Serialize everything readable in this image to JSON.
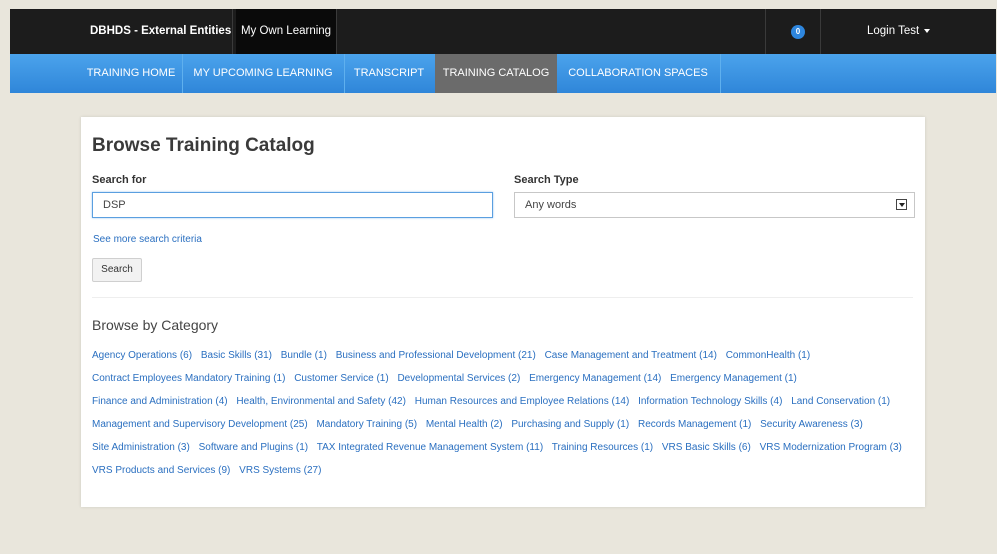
{
  "topbar": {
    "brand": "DBHDS - External Entities",
    "my_own_learning": "My Own Learning",
    "notification_count": "0",
    "user_label": "Login Test"
  },
  "nav": {
    "items": [
      "TRAINING HOME",
      "MY UPCOMING LEARNING",
      "TRANSCRIPT",
      "TRAINING CATALOG",
      "COLLABORATION SPACES"
    ],
    "active": "TRAINING CATALOG"
  },
  "catalog": {
    "title": "Browse Training Catalog",
    "search_for_label": "Search for",
    "search_value": "DSP",
    "search_type_label": "Search Type",
    "search_type_value": "Any words",
    "more_criteria": "See more search criteria",
    "search_button": "Search",
    "browse_title": "Browse by Category",
    "categories": [
      "Agency Operations (6)",
      "Basic Skills (31)",
      "Bundle (1)",
      "Business and Professional Development (21)",
      "Case Management and Treatment (14)",
      "CommonHealth (1)",
      "Contract Employees Mandatory Training (1)",
      "Customer Service (1)",
      "Developmental Services (2)",
      "Emergency Management (14)",
      "Emergency Management (1)",
      "Finance and Administration (4)",
      "Health, Environmental and Safety (42)",
      "Human Resources and Employee Relations (14)",
      "Information Technology Skills (4)",
      "Land Conservation (1)",
      "Management and Supervisory Development (25)",
      "Mandatory Training (5)",
      "Mental Health (2)",
      "Purchasing and Supply (1)",
      "Records Management (1)",
      "Security Awareness (3)",
      "Site Administration (3)",
      "Software and Plugins (1)",
      "TAX Integrated Revenue Management System (11)",
      "Training Resources (1)",
      "VRS Basic Skills (6)",
      "VRS Modernization Program (3)",
      "VRS Products and Services (9)",
      "VRS Systems (27)"
    ]
  },
  "colors": {
    "topbar": "#1c1c1c",
    "nav_blue": "#3a93e0",
    "nav_active": "#6b6b6b",
    "link": "#2a6fc0",
    "page_bg": "#e9e6dc"
  }
}
